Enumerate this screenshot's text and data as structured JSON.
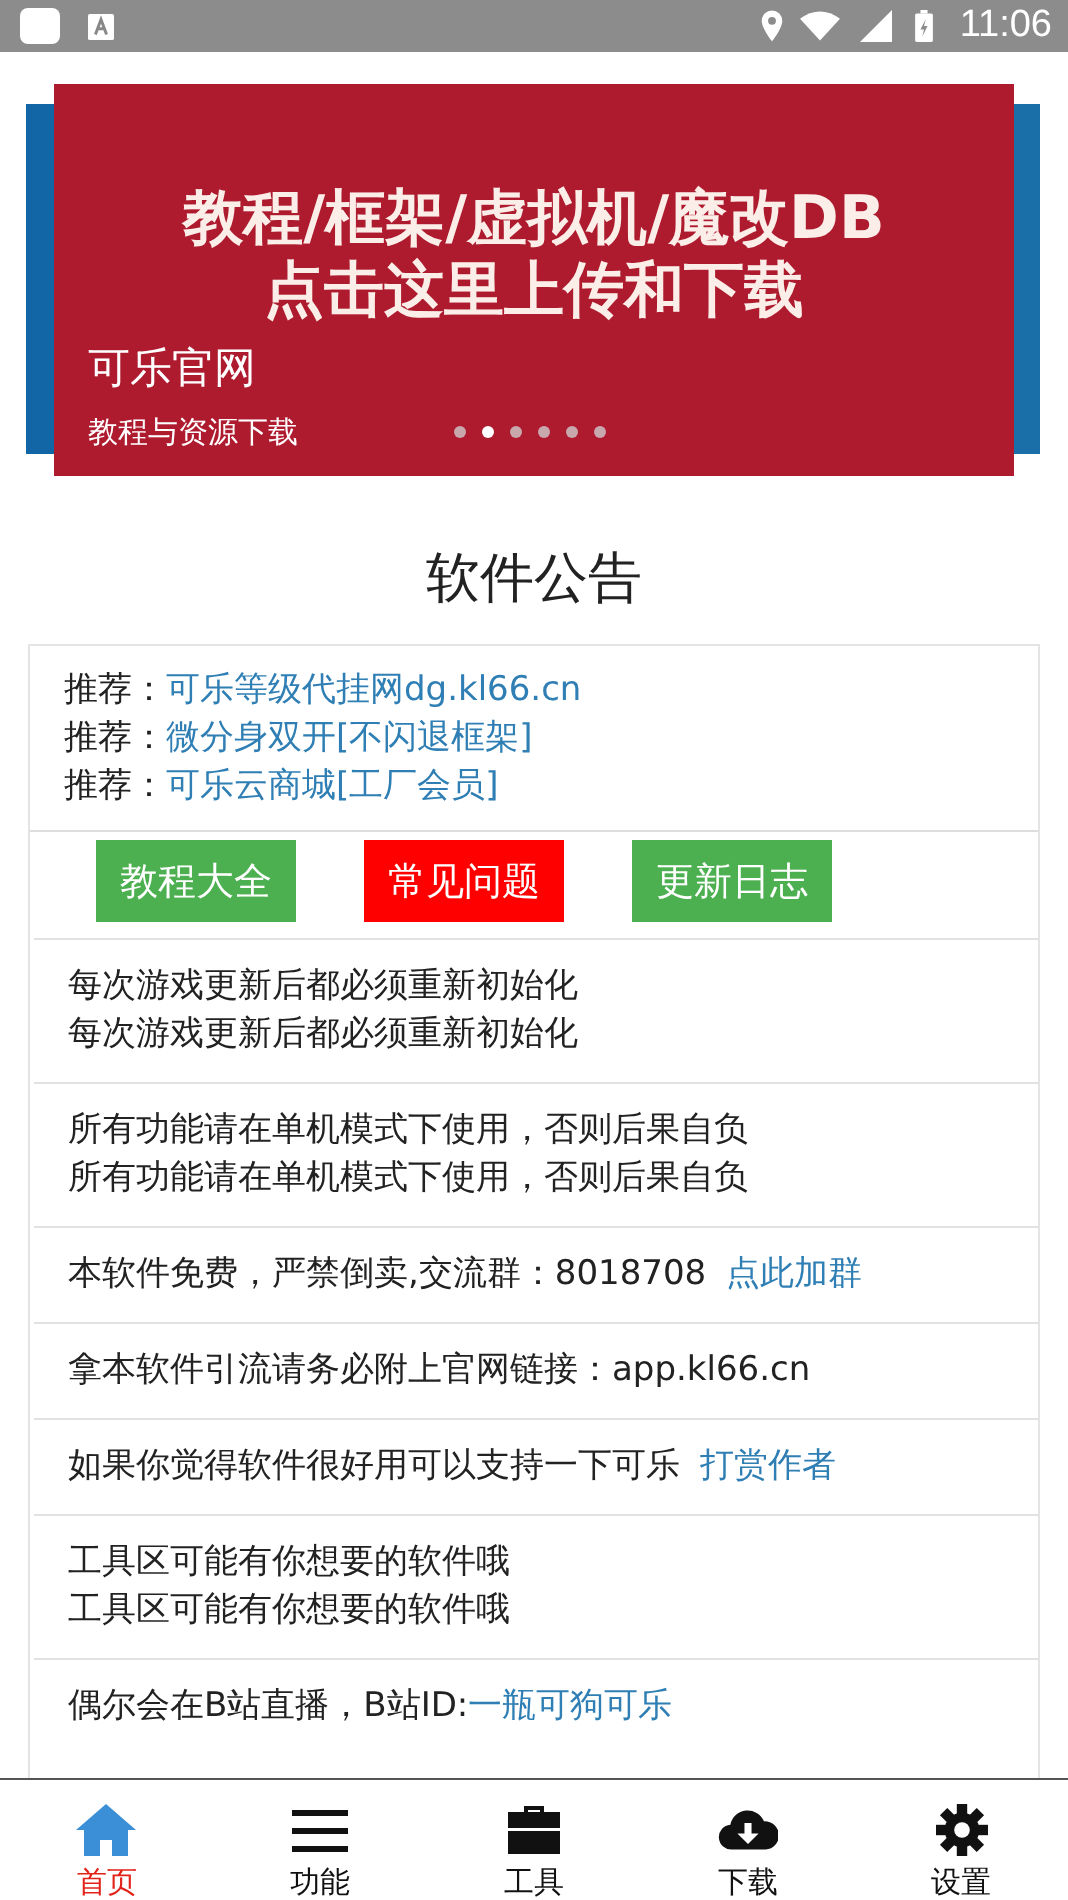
{
  "status_bar": {
    "time": "11:06"
  },
  "banner": {
    "headline": [
      "教程/框架/虚拟机/魔改DB",
      "点击这里上传和下载"
    ],
    "title": "可乐官网",
    "subtitle": "教程与资源下载",
    "dots": [
      {
        "selected": false
      },
      {
        "selected": true
      },
      {
        "selected": false
      },
      {
        "selected": false
      },
      {
        "selected": false
      },
      {
        "selected": false
      }
    ]
  },
  "section_title": "软件公告",
  "recommendations": [
    {
      "label": "推荐：",
      "link": "可乐等级代挂网dg.kl66.cn"
    },
    {
      "label": "推荐：",
      "link": "微分身双开[不闪退框架]"
    },
    {
      "label": "推荐：",
      "link": "可乐云商城[工厂会员]"
    }
  ],
  "buttons": [
    {
      "label": "教程大全",
      "color": "#4caf50"
    },
    {
      "label": "常见问题",
      "color": "#ff0000"
    },
    {
      "label": "更新日志",
      "color": "#4caf50"
    }
  ],
  "notices": [
    {
      "lines": [
        "每次游戏更新后都必须重新初始化",
        "每次游戏更新后都必须重新初始化"
      ]
    },
    {
      "lines": [
        "所有功能请在单机模式下使用，否则后果自负",
        "所有功能请在单机模式下使用，否则后果自负"
      ]
    },
    {
      "lines": [
        "本软件免费，严禁倒卖,交流群：8018708"
      ],
      "link": "点此加群"
    },
    {
      "lines": [
        "拿本软件引流请务必附上官网链接：app.kl66.cn"
      ]
    },
    {
      "lines": [
        "如果你觉得软件很好用可以支持一下可乐"
      ],
      "link": "打赏作者"
    },
    {
      "lines": [
        "工具区可能有你想要的软件哦",
        "工具区可能有你想要的软件哦"
      ]
    },
    {
      "lines": [
        "偶尔会在B站直播，B站ID:"
      ],
      "link": "一瓶可狗可乐",
      "kind": "inline_link"
    }
  ],
  "nav": [
    {
      "kind": "home",
      "label": "首页",
      "selected": true
    },
    {
      "kind": "menu",
      "label": "功能",
      "selected": false
    },
    {
      "kind": "toolbox",
      "label": "工具",
      "selected": false
    },
    {
      "kind": "download",
      "label": "下载",
      "selected": false
    },
    {
      "kind": "settings",
      "label": "设置",
      "selected": false
    }
  ]
}
